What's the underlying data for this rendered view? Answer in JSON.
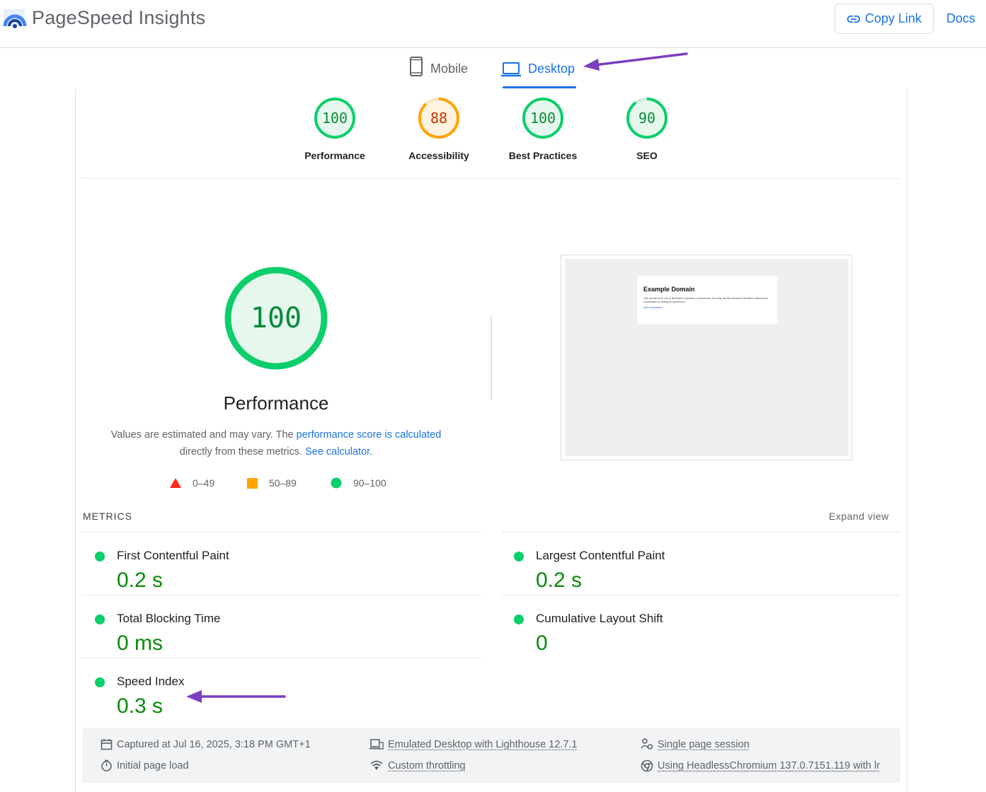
{
  "header": {
    "app_title": "PageSpeed Insights",
    "copy_link": "Copy Link",
    "docs": "Docs"
  },
  "tabs": {
    "mobile": "Mobile",
    "desktop": "Desktop",
    "active": "Desktop"
  },
  "scores": [
    {
      "value": "100",
      "label": "Performance",
      "status": "pass",
      "color": "#0cce6b"
    },
    {
      "value": "88",
      "label": "Accessibility",
      "status": "average",
      "color": "#ffa400"
    },
    {
      "value": "100",
      "label": "Best Practices",
      "status": "pass",
      "color": "#0cce6b"
    },
    {
      "value": "90",
      "label": "SEO",
      "status": "pass",
      "color": "#0cce6b"
    }
  ],
  "performance": {
    "score": "100",
    "title": "Performance",
    "desc_prefix": "Values are estimated and may vary. The",
    "desc_link1": "performance score is calculated",
    "desc_mid": "directly from these metrics.",
    "desc_link2": "See calculator."
  },
  "legend": {
    "fail": "0–49",
    "average": "50–89",
    "pass": "90–100"
  },
  "screenshot": {
    "heading": "Example Domain",
    "body": "This domain is for use in illustrative examples in documents. You may use this domain in literature without prior coordination or asking for permission.",
    "link": "More information..."
  },
  "metrics": {
    "title": "METRICS",
    "expand": "Expand view",
    "items": [
      {
        "name": "First Contentful Paint",
        "value": "0.2 s"
      },
      {
        "name": "Largest Contentful Paint",
        "value": "0.2 s"
      },
      {
        "name": "Total Blocking Time",
        "value": "0 ms"
      },
      {
        "name": "Cumulative Layout Shift",
        "value": "0"
      },
      {
        "name": "Speed Index",
        "value": "0.3 s"
      }
    ]
  },
  "footer": {
    "captured": "Captured at Jul 16, 2025, 3:18 PM GMT+1",
    "initial_load": "Initial page load",
    "emulated": "Emulated Desktop with Lighthouse 12.7.1",
    "throttling": "Custom throttling",
    "session": "Single page session",
    "browser": "Using HeadlessChromium 137.0.7151.119 with lr"
  },
  "colors": {
    "accent": "#1a73e8",
    "pass": "#0cce6b",
    "average": "#ffa400",
    "fail": "#ff4e42",
    "annotation_arrow": "#7b3fc0"
  }
}
